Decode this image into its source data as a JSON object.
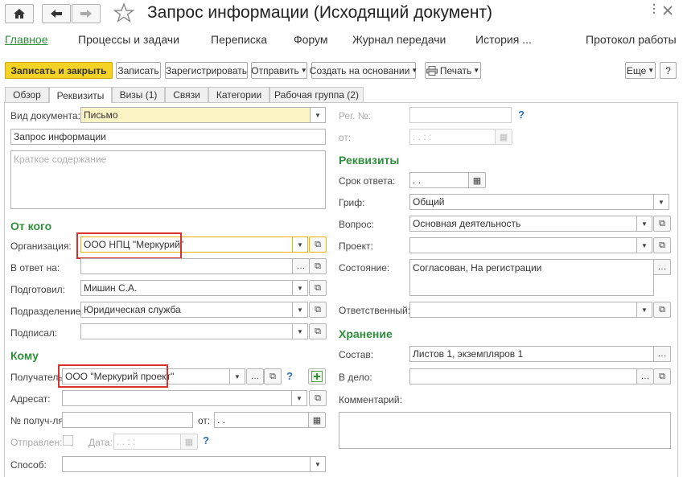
{
  "nav": {
    "home_icon": "home-icon",
    "back_icon": "arrow-left-icon",
    "forward_icon": "arrow-right-icon",
    "favorite_icon": "star-icon"
  },
  "window": {
    "title": "Запрос информации (Исходящий документ)",
    "close_icon": "close-icon",
    "more_icon": "more-dots-icon"
  },
  "sections": {
    "main": "Главное",
    "processes": "Процессы и задачи",
    "correspondence": "Переписка",
    "forum": "Форум",
    "transfer_log": "Журнал передачи",
    "history": "История ...",
    "work_protocol": "Протокол работы"
  },
  "toolbar": {
    "save_close": "Записать и закрыть",
    "save": "Записать",
    "register": "Зарегистрировать",
    "send": "Отправить",
    "create_based": "Создать на основании",
    "print": "Печать",
    "more": "Еще",
    "help": "?",
    "print_icon": "printer-icon"
  },
  "tabs": [
    "Обзор",
    "Реквизиты",
    "Визы (1)",
    "Связи",
    "Категории",
    "Рабочая группа (2)"
  ],
  "left": {
    "doc_kind_label": "Вид документа:",
    "doc_kind": "Письмо",
    "subject": "Запрос информации",
    "summary_placeholder": "Краткое содержание",
    "from_section": "От кого",
    "org_label": "Организация:",
    "org": "ООО НПЦ \"Меркурий\"",
    "reply_to_label": "В ответ на:",
    "reply_to": "",
    "prepared_label": "Подготовил:",
    "prepared": "Мишин С.А.",
    "dept_label": "Подразделение:",
    "dept": "Юридическая служба",
    "signed_label": "Подписал:",
    "signed": "",
    "to_section": "Кому",
    "recipient_label": "Получатель:",
    "recipient": "ООО \"Меркурий проект\"",
    "addressee_label": "Адресат:",
    "addressee": "",
    "recv_no_label": "№ получ-ля:",
    "recv_no": "",
    "from_date_label": "от:",
    "from_date": " .  .",
    "sent_label": "Отправлен:",
    "date_label": "Дата:",
    "sent_date": " .  .      :  :",
    "method_label": "Способ:",
    "method": ""
  },
  "right": {
    "reg_no_label": "Рег. №:",
    "reg_no": "",
    "reg_date_label": "от:",
    "reg_date": " .  .      :  :",
    "req_section": "Реквизиты",
    "deadline_label": "Срок ответа:",
    "deadline": " .  .",
    "grif_label": "Гриф:",
    "grif": "Общий",
    "question_label": "Вопрос:",
    "question": "Основная деятельность",
    "project_label": "Проект:",
    "project": "",
    "state_label": "Состояние:",
    "state": "Согласован, На регистрации",
    "responsible_label": "Ответственный:",
    "responsible": "",
    "storage_section": "Хранение",
    "composition_label": "Состав:",
    "composition": "Листов 1, экземпляров 1",
    "case_label": "В дело:",
    "case": "",
    "comment_label": "Комментарий:",
    "comment": ""
  },
  "colors": {
    "accent": "#2f8f3c",
    "highlight": "#d9302c",
    "primary_button": "#f4d226",
    "focus": "#f0b400",
    "doc_kind_bg": "#fdf4c6",
    "help": "#2a6ebb"
  }
}
